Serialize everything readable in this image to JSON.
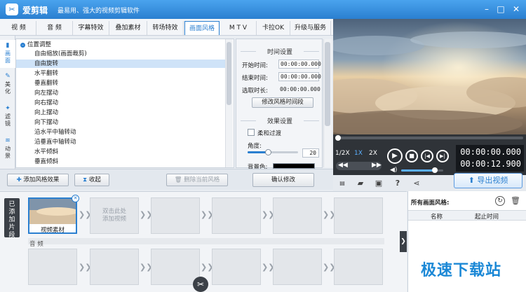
{
  "app": {
    "title": "爱剪辑",
    "slogan": "最易用、强大的视频剪辑软件",
    "logo_glyph": "✂"
  },
  "tabs": [
    {
      "label": "视  频"
    },
    {
      "label": "音  频"
    },
    {
      "label": "字幕特效"
    },
    {
      "label": "叠加素材"
    },
    {
      "label": "转场特效"
    },
    {
      "label": "画面风格",
      "active": true
    },
    {
      "label": "M T V"
    },
    {
      "label": "卡拉OK"
    },
    {
      "label": "升级与服务"
    }
  ],
  "sidenav": [
    {
      "label": "画\n面",
      "icon": "frame-icon",
      "active": true
    },
    {
      "label": "美\n化",
      "icon": "brush-icon"
    },
    {
      "label": "滤\n镜",
      "icon": "filter-icon"
    },
    {
      "label": "动\n景",
      "icon": "wave-icon"
    }
  ],
  "effects": {
    "group": "位置调整",
    "items": [
      "自由缩放(画面裁剪)",
      "自由旋转",
      "水平翻转",
      "垂直翻转",
      "向左摆动",
      "向右摆动",
      "向上摆动",
      "向下摆动",
      "沿水平中轴转动",
      "沿垂直中轴转动",
      "水平倾斜",
      "垂直倾斜"
    ],
    "selected_index": 1
  },
  "time_settings": {
    "header": "时间设置",
    "start_label": "开始时间:",
    "start_value": "00:00:00.000",
    "end_label": "结束时间:",
    "end_value": "00:00:00.000",
    "duration_label": "选取时长:",
    "duration_value": "00:00:00.000",
    "modify_button": "修改风格时间段"
  },
  "effect_settings": {
    "header": "效果设置",
    "soft_transition": "柔和过渡",
    "angle_label": "角度:",
    "angle_value": "20",
    "angle_fraction": 0.4,
    "bg_color_label": "背景色:",
    "bg_color": "#000000"
  },
  "actions": {
    "add_style": "添加风格效果",
    "collapse": "收起",
    "delete_style": "删除当前风格",
    "confirm": "确认修改"
  },
  "player": {
    "speeds": [
      "1/2X",
      "1X",
      "2X"
    ],
    "active_speed": "1X",
    "time_current": "00:00:00.000",
    "time_total": "00:00:12.900",
    "progress": 0.0,
    "volume": 0.8
  },
  "export_button": "导出视频",
  "timeline": {
    "added_label": "已\n添\n加\n片\n段",
    "clip_caption": "视频素材",
    "placeholder": "双击此处\n添加视频",
    "audio_label": "音  频"
  },
  "styles_panel": {
    "title": "所有画面风格:",
    "col_name": "名称",
    "col_time": "起止时间"
  },
  "watermark": "极速下载站"
}
